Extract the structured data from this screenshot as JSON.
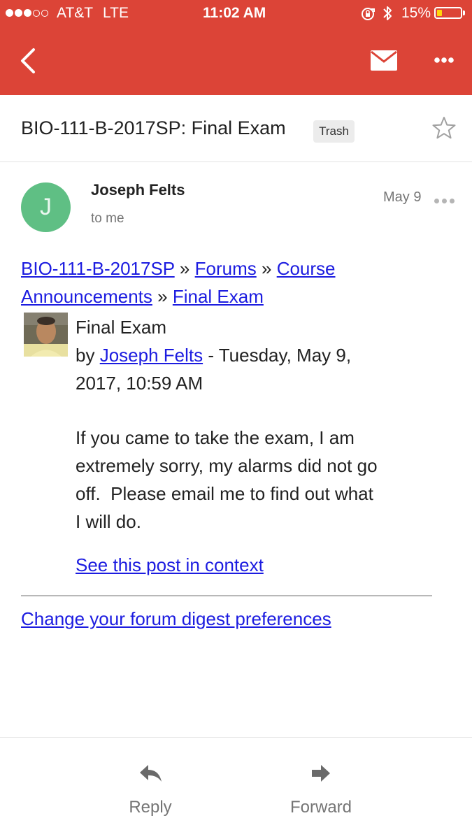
{
  "status_bar": {
    "carrier": "AT&T",
    "network": "LTE",
    "time": "11:02 AM",
    "battery": "15%",
    "signal_bars": 3,
    "signal_total": 5
  },
  "colors": {
    "app_bar": "#dc4437",
    "avatar": "#5fbf84",
    "link": "#1c1ce0",
    "battery_fill": "#ffd60a"
  },
  "toolbar": {
    "back_icon": "chevron-left-icon",
    "mail_icon": "envelope-icon",
    "more_icon": "more-horizontal-icon"
  },
  "email": {
    "subject": "BIO-111-B-2017SP: Final Exam",
    "label": "Trash",
    "sender_initial": "J",
    "sender_name": "Joseph Felts",
    "recipient": "to me",
    "date": "May 9"
  },
  "message": {
    "breadcrumb": {
      "crumb1": "BIO-111-B-2017SP",
      "crumb2": "Forums",
      "crumb3a": "Course",
      "crumb3b": "Announcements",
      "crumb4": "Final Exam",
      "separator": "»"
    },
    "post_title": "Final Exam",
    "by": "by",
    "author": "Joseph Felts",
    "posted_at_line1": "- Tuesday, May 9,",
    "posted_at_line2": "2017, 10:59 AM",
    "body_lines": [
      "If you came to take the exam, I am",
      "extremely sorry, my alarms did not go",
      "off.  Please email me to find out what",
      "I will do."
    ],
    "context_link": "See this post in context",
    "preferences_link": "Change your forum digest preferences"
  },
  "actions": {
    "reply_label": "Reply",
    "forward_label": "Forward"
  }
}
